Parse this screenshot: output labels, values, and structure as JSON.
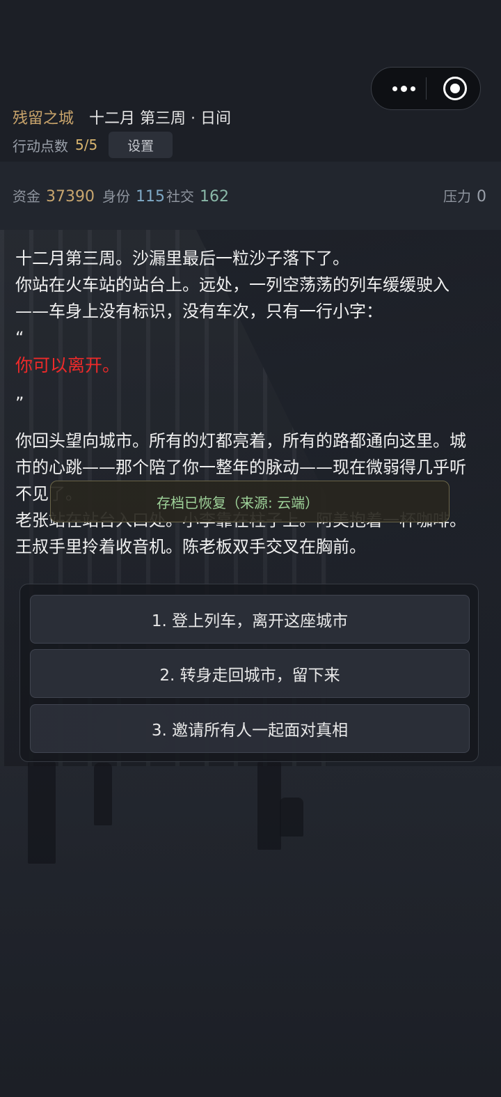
{
  "header": {
    "game_title": "残留之城",
    "date": "十二月 第三周 · 日间",
    "action_points_label": "行动点数",
    "action_points_value": "5/5",
    "settings_label": "设置"
  },
  "capsule": {
    "more_icon": "more-dots-icon",
    "close_icon": "target-close-icon"
  },
  "stats": {
    "money_label": "资金",
    "money_value": "37390",
    "status_label": "身份",
    "status_value": "115",
    "social_label": "社交",
    "social_value": "162",
    "stress_label": "压力",
    "stress_value": "0"
  },
  "story": {
    "p1": "十二月第三周。沙漏里最后一粒沙子落下了。",
    "p2": "你站在火车站的站台上。远处，一列空荡荡的列车缓缓驶入——车身上没有标识，没有车次，只有一行小字：",
    "open_quote": "“",
    "highlight": "你可以离开。",
    "close_quote": "”",
    "p3": "你回头望向城市。所有的灯都亮着，所有的路都通向这里。城市的心跳——那个陪了你一整年的脉动——现在微弱得几乎听不见了。",
    "p4": "老张站在站台入口处。小李靠在柱子上。阿美抱着一杯咖啡。王叔手里拎着收音机。陈老板双手交叉在胸前。"
  },
  "toast": {
    "text": "存档已恢复（来源: 云端）"
  },
  "choices": [
    {
      "label": "1. 登上列车，离开这座城市"
    },
    {
      "label": "2. 转身走回城市，留下来"
    },
    {
      "label": "3. 邀请所有人一起面对真相"
    }
  ],
  "colors": {
    "accent_gold": "#c9a46b",
    "highlight_red": "#ee2a2a",
    "toast_green": "#9fd39a"
  }
}
